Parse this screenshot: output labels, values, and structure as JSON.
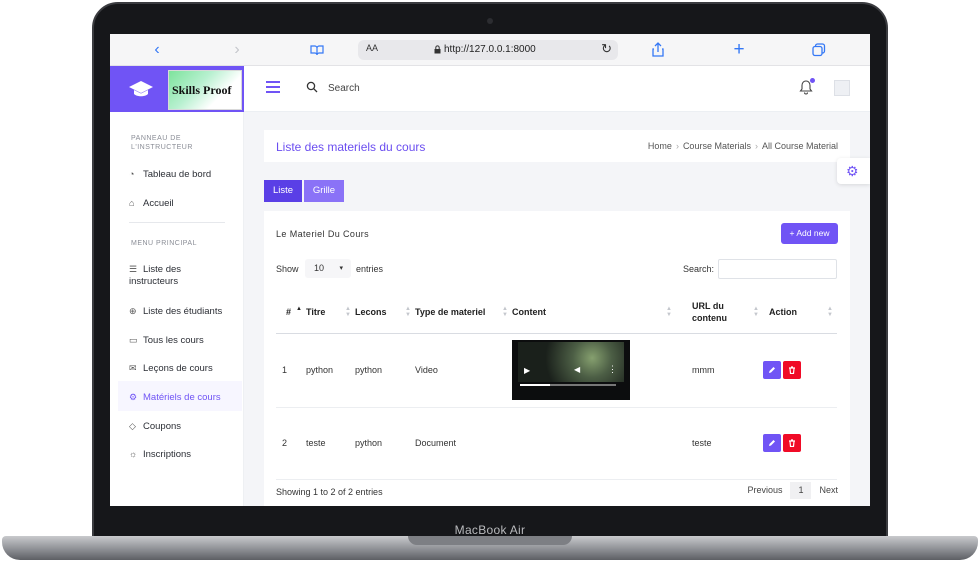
{
  "device": {
    "model": "MacBook Air"
  },
  "browser": {
    "text_size": "AA",
    "url": "http://127.0.0.1:8000",
    "icons": [
      "chevron-left-icon",
      "chevron-right-icon",
      "book-icon",
      "lock-icon",
      "reload-icon",
      "share-icon",
      "plus-icon",
      "tabs-icon"
    ]
  },
  "brand": {
    "name": "Skills Proof",
    "color": "#7054f5"
  },
  "topbar": {
    "search_label": "Search"
  },
  "sidebar": {
    "section1": "PANNEAU DE L'INSTRUCTEUR",
    "section2": "MENU PRINCIPAL",
    "items": [
      {
        "label": "Tableau de bord",
        "icon": "dashboard-icon"
      },
      {
        "label": "Accueil",
        "icon": "home-icon"
      },
      {
        "label": "Liste des instructeurs",
        "icon": "list-icon"
      },
      {
        "label": "Liste des étudiants",
        "icon": "globe-icon"
      },
      {
        "label": "Tous les cours",
        "icon": "book-icon"
      },
      {
        "label": "Leçons de cours",
        "icon": "mail-icon"
      },
      {
        "label": "Matériels de cours",
        "icon": "gear-icon",
        "active": true
      },
      {
        "label": "Coupons",
        "icon": "tag-icon"
      },
      {
        "label": "Inscriptions",
        "icon": "sun-icon"
      }
    ]
  },
  "page": {
    "title": "Liste des materiels du cours",
    "breadcrumbs": [
      "Home",
      "Course Materials",
      "All Course Material"
    ]
  },
  "views": {
    "list": "Liste",
    "grid": "Grille"
  },
  "table_card": {
    "title": "Le Materiel Du Cours",
    "add_button": "+ Add new",
    "show_label": "Show",
    "entries_value": "10",
    "entries_label": "entries",
    "search_label": "Search:",
    "columns": [
      "#",
      "Titre",
      "Lecons",
      "Type de materiel",
      "Content",
      "URL du contenu",
      "Action"
    ],
    "rows": [
      {
        "num": "1",
        "titre": "python",
        "lecon": "python",
        "type": "Video",
        "url": "mmm"
      },
      {
        "num": "2",
        "titre": "teste",
        "lecon": "python",
        "type": "Document",
        "url": "teste"
      }
    ],
    "info": "Showing 1 to 2 of 2 entries",
    "pager": {
      "previous": "Previous",
      "current": "1",
      "next": "Next"
    }
  },
  "colors": {
    "accent": "#7054f5",
    "danger": "#f00b27",
    "liste_btn": "#5a3fe6",
    "grille_btn": "#8a72f7"
  }
}
